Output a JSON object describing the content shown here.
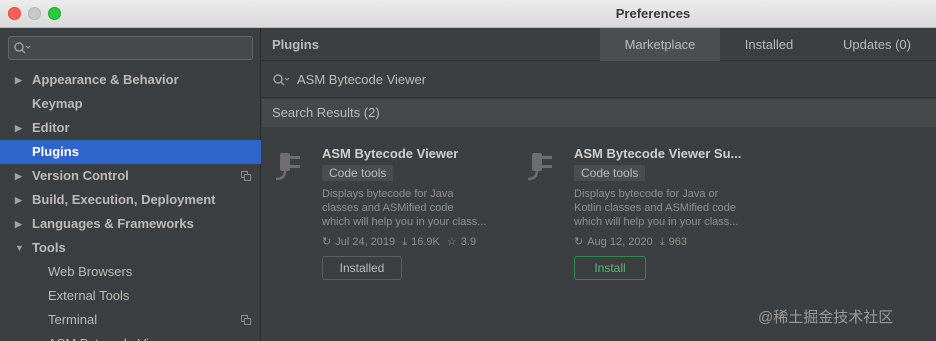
{
  "window": {
    "title": "Preferences"
  },
  "sidebar": {
    "search_placeholder": "",
    "items": [
      {
        "label": "Appearance & Behavior",
        "arrow": "▶"
      },
      {
        "label": "Keymap",
        "arrow": ""
      },
      {
        "label": "Editor",
        "arrow": "▶"
      },
      {
        "label": "Plugins",
        "arrow": ""
      },
      {
        "label": "Version Control",
        "arrow": "▶"
      },
      {
        "label": "Build, Execution, Deployment",
        "arrow": "▶"
      },
      {
        "label": "Languages & Frameworks",
        "arrow": "▶"
      },
      {
        "label": "Tools",
        "arrow": "▼"
      },
      {
        "label": "Web Browsers"
      },
      {
        "label": "External Tools"
      },
      {
        "label": "Terminal"
      },
      {
        "label": "ASM Bytecode Viewer"
      }
    ]
  },
  "header": {
    "title": "Plugins",
    "tabs": [
      {
        "label": "Marketplace"
      },
      {
        "label": "Installed"
      },
      {
        "label": "Updates (0)"
      }
    ]
  },
  "search": {
    "query": "ASM Bytecode Viewer"
  },
  "results": {
    "label": "Search Results (2)",
    "plugins": [
      {
        "name": "ASM Bytecode Viewer",
        "tag": "Code tools",
        "description": [
          "Displays bytecode for Java",
          "classes and ASMified code",
          "which will help you in your class..."
        ],
        "date": "Jul 24, 2019",
        "downloads": "16.9K",
        "rating": "3.9",
        "button": "Installed"
      },
      {
        "name": "ASM Bytecode Viewer Su...",
        "tag": "Code tools",
        "description": [
          "Displays bytecode for Java or",
          "Kotlin classes and ASMified code",
          "which will help you in your class..."
        ],
        "date": "Aug 12, 2020",
        "downloads": "963",
        "button": "Install"
      }
    ]
  },
  "watermark": "@稀土掘金技术社区"
}
